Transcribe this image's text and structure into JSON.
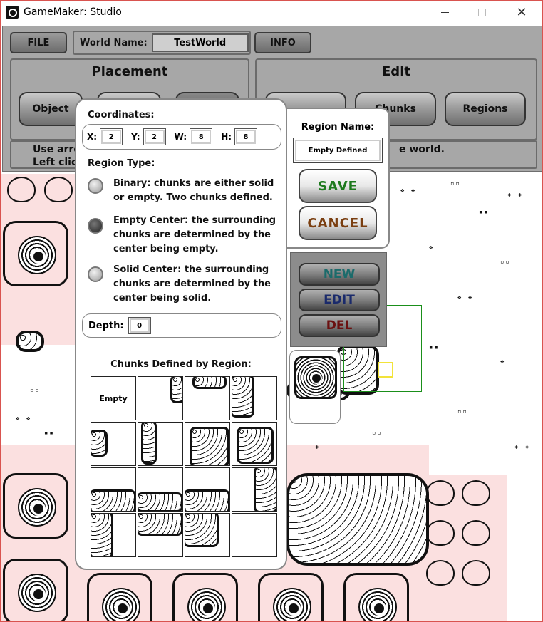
{
  "window": {
    "title": "GameMaker: Studio"
  },
  "toolbar": {
    "file_label": "FILE",
    "world_name_label": "World Name:",
    "world_name_value": "TestWorld",
    "info_label": "INFO"
  },
  "placement": {
    "title": "Placement",
    "buttons": [
      "Object",
      "",
      ""
    ]
  },
  "edit": {
    "title": "Edit",
    "buttons": [
      "",
      "Chunks",
      "Regions"
    ]
  },
  "help": {
    "left_line1": "Use arro",
    "left_line2": "Left clic",
    "right_line1": "e world."
  },
  "region_dialog": {
    "coordinates_label": "Coordinates:",
    "x_label": "X:",
    "x_value": "2",
    "y_label": "Y:",
    "y_value": "2",
    "w_label": "W:",
    "w_value": "8",
    "h_label": "H:",
    "h_value": "8",
    "region_type_label": "Region Type:",
    "options": [
      {
        "text": "Binary: chunks are either solid or empty. Two chunks defined.",
        "selected": false
      },
      {
        "text": "Empty Center: the surrounding chunks are determined by the center being empty.",
        "selected": true
      },
      {
        "text": "Solid Center: the surrounding chunks are determined by the center being solid.",
        "selected": false
      }
    ],
    "depth_label": "Depth:",
    "depth_value": "0",
    "chunks_label": "Chunks Defined by Region:",
    "first_tile_label": "Empty"
  },
  "region_name": {
    "label": "Region Name:",
    "value": "Empty Defined",
    "save_label": "SAVE",
    "cancel_label": "CANCEL"
  },
  "region_list": {
    "new_label": "NEW",
    "edit_label": "EDIT",
    "del_label": "DEL"
  },
  "colors": {
    "panel_gray": "#a7a7a7",
    "map_pink": "#fbe0e0",
    "save_green": "#1e7a1e",
    "cancel_brown": "#7a3e10",
    "selection_green": "#1a8f1a",
    "cursor_yellow": "#f2e33a"
  }
}
